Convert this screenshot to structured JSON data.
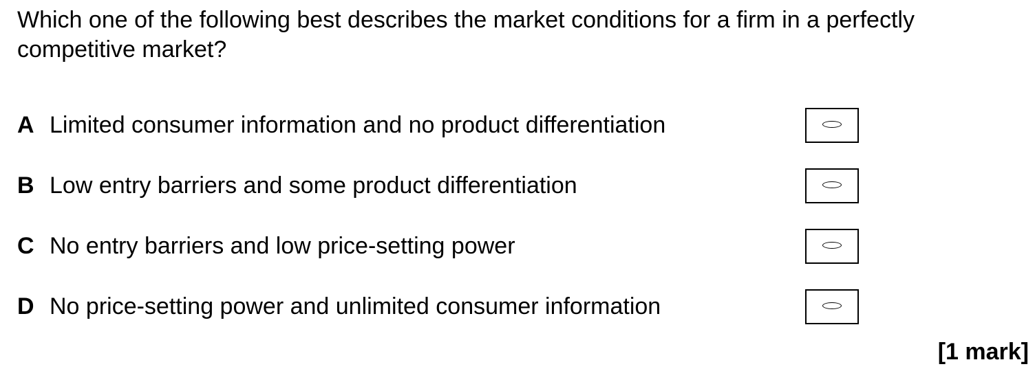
{
  "question": {
    "text": "Which one of the following best describes the market conditions for a firm in a perfectly competitive market?"
  },
  "options": [
    {
      "letter": "A",
      "text": "Limited consumer information and no product differentiation"
    },
    {
      "letter": "B",
      "text": "Low entry barriers and some product differentiation"
    },
    {
      "letter": "C",
      "text": "No entry barriers and low price-setting power"
    },
    {
      "letter": "D",
      "text": "No price-setting power and unlimited consumer information"
    }
  ],
  "marks": "[1 mark]"
}
